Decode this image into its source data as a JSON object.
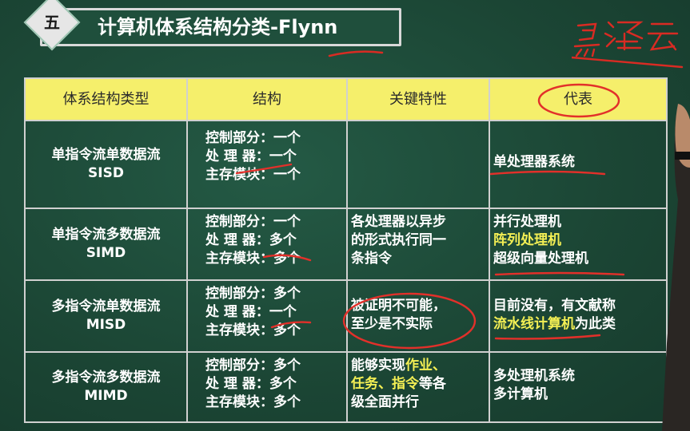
{
  "slide": {
    "badge": "五",
    "title": "计算机体系结构分类-Flynn",
    "signature": "马泽云"
  },
  "table": {
    "headers": [
      "体系结构类型",
      "结构",
      "关键特性",
      "代表"
    ],
    "rows": [
      {
        "type_cn": "单指令流单数据流",
        "type_en": "SISD",
        "structure": [
          "控制部分：一个",
          "处 理 器：一个",
          "主存模块：一个"
        ],
        "feature": [],
        "representative": [
          "单处理器系统"
        ]
      },
      {
        "type_cn": "单指令流多数据流",
        "type_en": "SIMD",
        "structure": [
          "控制部分：一个",
          "处 理 器：多个",
          "主存模块：多个"
        ],
        "feature": [
          "各处理器以异步",
          "的形式执行同一",
          "条指令"
        ],
        "representative": [
          "并行处理机",
          "阵列处理机",
          "超级向量处理机"
        ]
      },
      {
        "type_cn": "多指令流单数据流",
        "type_en": "MISD",
        "structure": [
          "控制部分：多个",
          "处 理 器：一个",
          "主存模块：多个"
        ],
        "feature": [
          "被证明不可能，",
          "至少是不实际"
        ],
        "representative_line1": "目前没有，有文献称",
        "representative_line2_highlight": "流水线计算机",
        "representative_line2_rest": "为此类"
      },
      {
        "type_cn": "多指令流多数据流",
        "type_en": "MIMD",
        "structure": [
          "控制部分：多个",
          "处 理 器：多个",
          "主存模块：多个"
        ],
        "feature_l1_a": "能够实现",
        "feature_l1_b": "作业、",
        "feature_l2_a": "任务、指令",
        "feature_l2_b": "等各",
        "feature_l3": "级全面并行",
        "representative": [
          "多处理机系统",
          "多计算机"
        ]
      }
    ]
  },
  "colors": {
    "board": "#1d4a38",
    "header_bg": "#f5ef6b",
    "highlight": "#f3ef54",
    "annotation": "#e2302a"
  }
}
